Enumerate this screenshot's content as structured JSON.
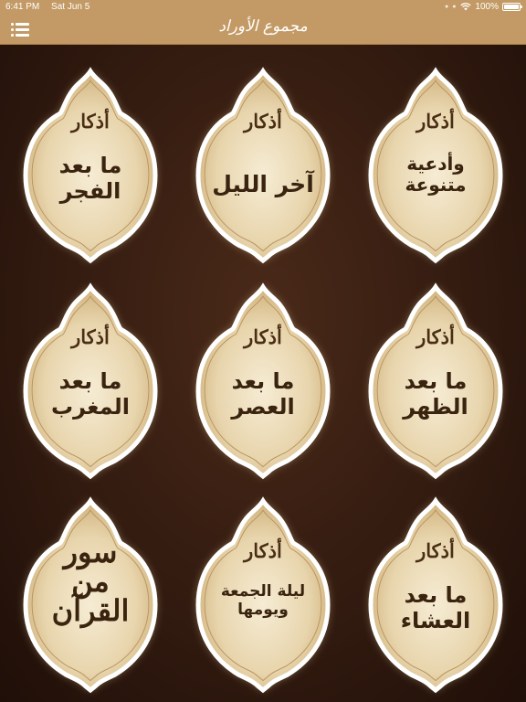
{
  "status_bar": {
    "time": "6:41 PM",
    "date": "Sat Jun 5",
    "battery": "100%",
    "icons": [
      "signal-dots-icon",
      "wifi-icon",
      "battery-icon"
    ]
  },
  "nav": {
    "title": "مجموع الأوراد",
    "menu_icon": "hamburger-menu-icon"
  },
  "colors": {
    "bar": "#c39a65",
    "background": "#331b10",
    "card_fill": "#e8d5ad",
    "card_border": "#ffffff",
    "text": "#3a2410"
  },
  "cards": [
    {
      "header": "أذكار",
      "lines": [
        "وأدعية",
        "متنوعة"
      ]
    },
    {
      "header": "أذكار",
      "lines": [
        "آخر الليل"
      ]
    },
    {
      "header": "أذكار",
      "lines": [
        "ما بعد",
        "الفجر"
      ]
    },
    {
      "header": "أذكار",
      "lines": [
        "ما بعد",
        "الظهر"
      ]
    },
    {
      "header": "أذكار",
      "lines": [
        "ما بعد",
        "العصر"
      ]
    },
    {
      "header": "أذكار",
      "lines": [
        "ما بعد",
        "المغرب"
      ]
    },
    {
      "header": "أذكار",
      "lines": [
        "ما بعد",
        "العشاء"
      ]
    },
    {
      "header": "أذكار",
      "lines": [
        "ليلة الجمعة",
        "ويومها"
      ]
    },
    {
      "header": "",
      "lines": [
        "سور",
        "من",
        "القرآن"
      ]
    }
  ]
}
